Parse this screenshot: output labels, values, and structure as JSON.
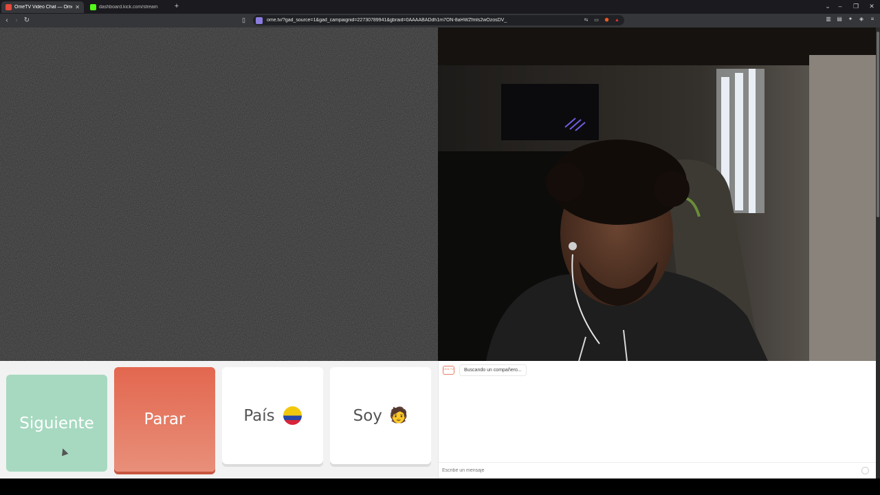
{
  "browser": {
    "tabs": [
      {
        "label": "OmeTV Video Chat — Omegle",
        "active": true,
        "favicon_color": "#e24a3b"
      },
      {
        "label": "dashboard.kick.com/stream",
        "active": false,
        "favicon_color": "#53fc18"
      }
    ],
    "new_tab_icon": "plus-icon",
    "url": "ome.tv/?gad_source=1&gad_campaignid=22730789941&gbraid=0AAAABADdh1m7ON-8aHWZfmls2wOzosDV_",
    "window_controls": [
      "chevron-down-icon",
      "minimize-icon",
      "restore-icon",
      "close-icon"
    ]
  },
  "controls": {
    "next_label": "Siguiente",
    "stop_label": "Parar",
    "country_label": "País",
    "country_flag": "colombia-flag-icon",
    "gender_label": "Soy",
    "gender_emoji": "🧑",
    "colors": {
      "next": "#a6d9c0",
      "stop": "#e3674f",
      "neutral": "#ffffff"
    }
  },
  "chat": {
    "logo_text": "Ome TV",
    "status_message": "Buscando un compañero...",
    "input_placeholder": "Escribe un mensaje"
  }
}
